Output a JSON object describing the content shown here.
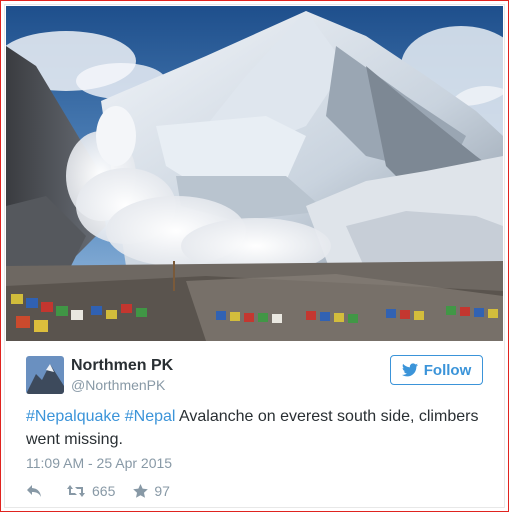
{
  "tweet": {
    "author_name": "Northmen PK",
    "author_handle": "@NorthmenPK",
    "follow_label": "Follow",
    "hashtag_1": "#Nepalquake",
    "hashtag_2": "#Nepal",
    "text": "Avalanche on everest south side, climbers went missing.",
    "timestamp": "11:09 AM - 25 Apr 2015",
    "retweet_count": "665",
    "favorite_count": "97"
  },
  "icons": {
    "follow": "twitter-bird-icon",
    "reply": "reply-icon",
    "retweet": "retweet-icon",
    "favorite": "star-icon"
  },
  "colors": {
    "link_blue": "#3b94d9",
    "muted_gray": "#8899a6",
    "text_dark": "#292f33",
    "frame_red": "#e0231f"
  }
}
